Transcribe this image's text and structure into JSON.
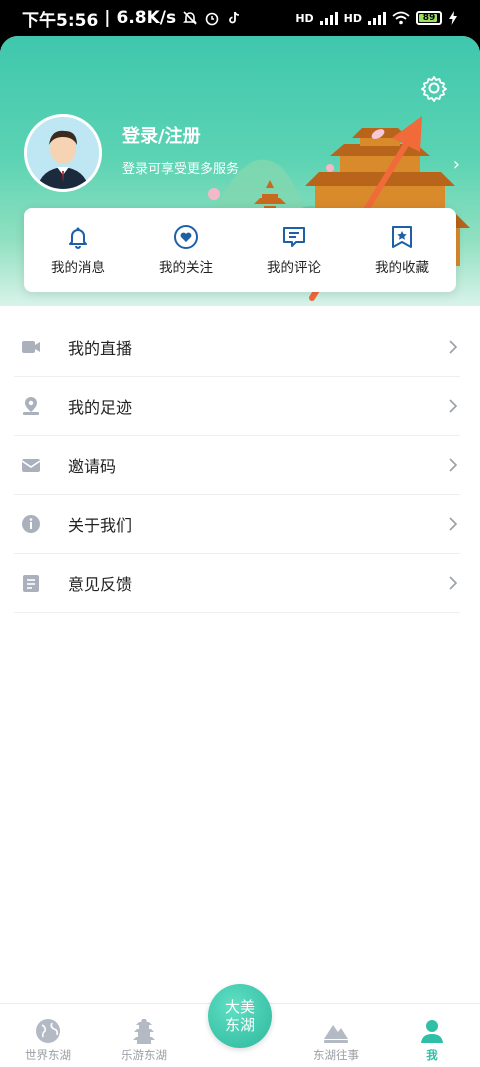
{
  "status_bar": {
    "time": "下午5:56",
    "speed": "6.8K/s",
    "separator": "|",
    "network_1": "HD",
    "network_2": "HD",
    "battery": "89"
  },
  "profile": {
    "login_title": "登录/注册",
    "login_subtitle": "登录可享受更多服务"
  },
  "quick_actions": [
    {
      "label": "我的消息",
      "icon": "bell-icon"
    },
    {
      "label": "我的关注",
      "icon": "heart-icon"
    },
    {
      "label": "我的评论",
      "icon": "comment-icon"
    },
    {
      "label": "我的收藏",
      "icon": "bookmark-star-icon"
    }
  ],
  "menu": [
    {
      "label": "我的直播",
      "icon": "video-icon"
    },
    {
      "label": "我的足迹",
      "icon": "location-pin-icon"
    },
    {
      "label": "邀请码",
      "icon": "envelope-icon"
    },
    {
      "label": "关于我们",
      "icon": "info-icon"
    },
    {
      "label": "意见反馈",
      "icon": "clipboard-icon"
    }
  ],
  "tabbar": {
    "tabs": [
      {
        "label": "世界东湖",
        "icon": "globe-icon"
      },
      {
        "label": "乐游东湖",
        "icon": "pagoda-icon"
      },
      {
        "label": "东湖往事",
        "icon": "mountain-icon"
      },
      {
        "label": "我",
        "icon": "user-icon",
        "active": true
      }
    ],
    "center_line1": "大美",
    "center_line2": "东湖"
  },
  "colors": {
    "accent": "#2fbfa6",
    "icon_blue": "#1f5fa8",
    "arrow": "#f06a3a"
  }
}
